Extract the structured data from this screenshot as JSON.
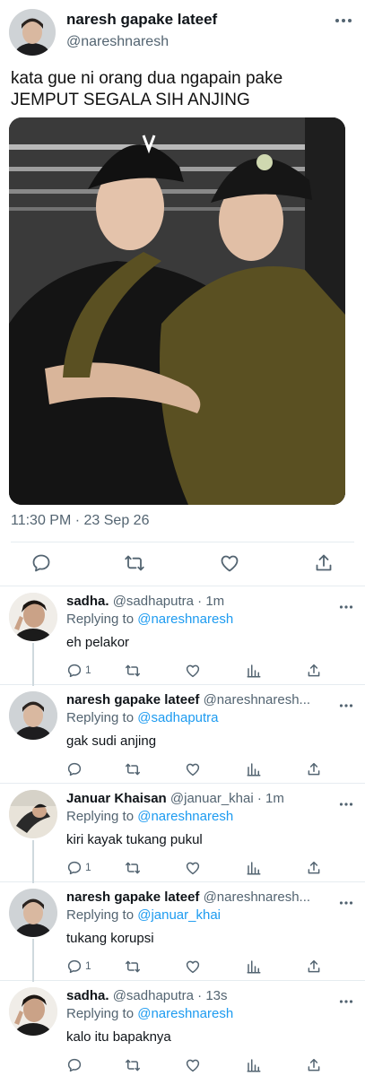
{
  "main_tweet": {
    "display_name": "naresh gapake lateef",
    "handle": "@nareshnaresh",
    "text_line1": "kata gue ni orang dua ngapain pake",
    "text_line2": "JEMPUT SEGALA SIH ANJING",
    "timestamp": "11:30 PM · 23 Sep 26",
    "actions": [
      "reply-icon",
      "retweet-icon",
      "like-icon",
      "share-icon"
    ]
  },
  "replies": [
    {
      "display_name": "sadha.",
      "meta": "@sadhaputra · 1m",
      "replying_label": "Replying to",
      "replying_to": "@nareshnaresh",
      "text": "eh pelakor",
      "reply_count": "1",
      "avatar": "avatar-sadha"
    },
    {
      "display_name": "naresh gapake lateef",
      "meta": "@nareshnaresh...",
      "replying_label": "Replying to",
      "replying_to": "@sadhaputra",
      "text": "gak sudi anjing",
      "reply_count": "",
      "avatar": "avatar-naresh"
    },
    {
      "display_name": "Januar Khaisan",
      "meta": "@januar_khai · 1m",
      "replying_label": "Replying to",
      "replying_to": "@nareshnaresh",
      "text": "kiri kayak tukang pukul",
      "reply_count": "1",
      "avatar": "avatar-januar"
    },
    {
      "display_name": "naresh gapake lateef",
      "meta": "@nareshnaresh...",
      "replying_label": "Replying to",
      "replying_to": "@januar_khai",
      "text": "tukang korupsi",
      "reply_count": "1",
      "avatar": "avatar-naresh"
    },
    {
      "display_name": "sadha.",
      "meta": "@sadhaputra · 13s",
      "replying_label": "Replying to",
      "replying_to": "@nareshnaresh",
      "text": "kalo itu bapaknya",
      "reply_count": "",
      "avatar": "avatar-sadha"
    }
  ],
  "colors": {
    "link": "#1d9bf0",
    "secondary_text": "#536471",
    "divider": "#e6ecf0",
    "icon": "#536471"
  }
}
